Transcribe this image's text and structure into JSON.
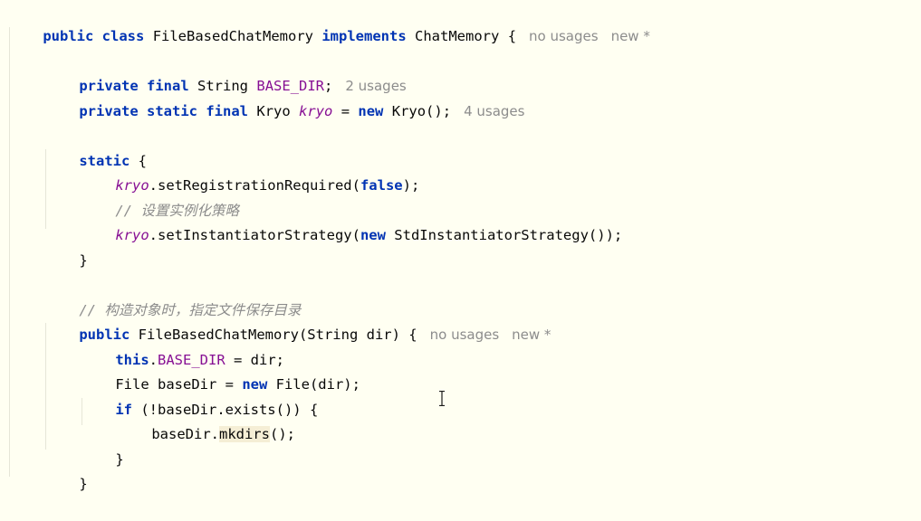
{
  "colors": {
    "background": "#fffff2",
    "keyword": "#0033b3",
    "field": "#871094",
    "comment": "#8c8c8c",
    "hint": "#8c8c8c"
  },
  "code": {
    "l1": {
      "kw_public": "public",
      "kw_class": "class",
      "class_name": "FileBasedChatMemory",
      "kw_implements": "implements",
      "iface": "ChatMemory",
      "brace": "{",
      "hint_usages": "no usages",
      "hint_new": "new *"
    },
    "l2": {
      "kw_private": "private",
      "kw_final": "final",
      "type": "String",
      "field": "BASE_DIR",
      "semi": ";",
      "hint_usages": "2 usages"
    },
    "l3": {
      "kw_private": "private",
      "kw_static": "static",
      "kw_final": "final",
      "type": "Kryo",
      "field": "kryo",
      "eq": "=",
      "kw_new": "new",
      "ctor": "Kryo();",
      "hint_usages": "4 usages"
    },
    "l4": {
      "kw_static": "static",
      "brace": "{"
    },
    "l5": {
      "field": "kryo",
      "call": ".setRegistrationRequired(",
      "kw_false": "false",
      "end": ");"
    },
    "l6": {
      "comment": "// 设置实例化策略"
    },
    "l7": {
      "field": "kryo",
      "call": ".setInstantiatorStrategy(",
      "kw_new": "new",
      "rest": "StdInstantiatorStrategy());"
    },
    "l8": {
      "brace": "}"
    },
    "l9": {
      "comment": "// 构造对象时，指定文件保存目录"
    },
    "l10": {
      "kw_public": "public",
      "sig": "FileBasedChatMemory(String dir) {",
      "hint_usages": "no usages",
      "hint_new": "new *"
    },
    "l11": {
      "kw_this": "this",
      "dot": ".",
      "field": "BASE_DIR",
      "rest": " = dir;"
    },
    "l12": {
      "pre": "File baseDir = ",
      "kw_new": "new",
      "rest": " File(dir);"
    },
    "l13": {
      "kw_if": "if",
      "rest": " (!baseDir.exists()) {"
    },
    "l14": {
      "pre": "baseDir.",
      "method": "mkdirs",
      "rest": "();"
    },
    "l15": {
      "brace": "}"
    },
    "l16": {
      "brace": "}"
    }
  },
  "icons": {
    "cursor": "text-cursor-icon"
  }
}
